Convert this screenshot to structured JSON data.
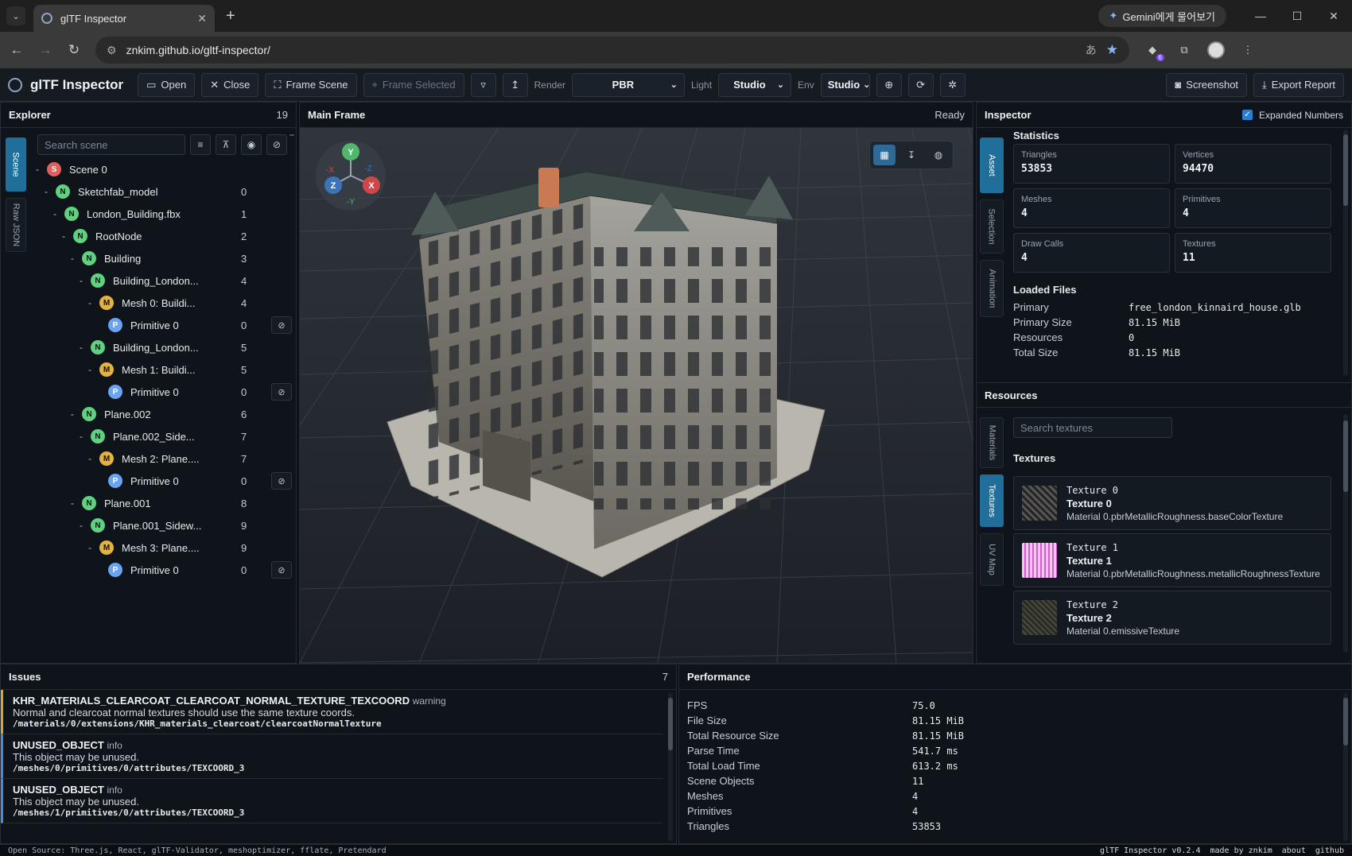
{
  "browser": {
    "tab_title": "glTF Inspector",
    "gemini_label": "Gemini에게 물어보기",
    "url": "znkim.github.io/gltf-inspector/",
    "extension_badge": "6"
  },
  "toolbar": {
    "brand": "glTF Inspector",
    "open": "Open",
    "close": "Close",
    "frame_scene": "Frame Scene",
    "frame_selected": "Frame Selected",
    "render_label": "Render",
    "render_value": "PBR",
    "light_label": "Light",
    "light_value": "Studio",
    "env_label": "Env",
    "env_value": "Studio",
    "screenshot": "Screenshot",
    "export": "Export Report"
  },
  "explorer": {
    "title": "Explorer",
    "count": "19",
    "tabs": [
      "Scene",
      "Raw JSON"
    ],
    "search_placeholder": "Search scene",
    "nodes": [
      {
        "toggle": "-",
        "badge": "S",
        "label": "Scene 0",
        "count": "",
        "depth": 0,
        "eye": false
      },
      {
        "toggle": "-",
        "badge": "N",
        "label": "Sketchfab_model",
        "count": "0",
        "depth": 1,
        "eye": false
      },
      {
        "toggle": "-",
        "badge": "N",
        "label": "London_Building.fbx",
        "count": "1",
        "depth": 2,
        "eye": false
      },
      {
        "toggle": "-",
        "badge": "N",
        "label": "RootNode",
        "count": "2",
        "depth": 3,
        "eye": false
      },
      {
        "toggle": "-",
        "badge": "N",
        "label": "Building",
        "count": "3",
        "depth": 4,
        "eye": false
      },
      {
        "toggle": "-",
        "badge": "N",
        "label": "Building_London...",
        "count": "4",
        "depth": 5,
        "eye": false
      },
      {
        "toggle": "-",
        "badge": "M",
        "label": "Mesh 0: Buildi...",
        "count": "4",
        "depth": 6,
        "eye": false
      },
      {
        "toggle": "",
        "badge": "P",
        "label": "Primitive 0",
        "count": "0",
        "depth": 7,
        "eye": true
      },
      {
        "toggle": "-",
        "badge": "N",
        "label": "Building_London...",
        "count": "5",
        "depth": 5,
        "eye": false
      },
      {
        "toggle": "-",
        "badge": "M",
        "label": "Mesh 1: Buildi...",
        "count": "5",
        "depth": 6,
        "eye": false
      },
      {
        "toggle": "",
        "badge": "P",
        "label": "Primitive 0",
        "count": "0",
        "depth": 7,
        "eye": true
      },
      {
        "toggle": "-",
        "badge": "N",
        "label": "Plane.002",
        "count": "6",
        "depth": 4,
        "eye": false
      },
      {
        "toggle": "-",
        "badge": "N",
        "label": "Plane.002_Side...",
        "count": "7",
        "depth": 5,
        "eye": false
      },
      {
        "toggle": "-",
        "badge": "M",
        "label": "Mesh 2: Plane....",
        "count": "7",
        "depth": 6,
        "eye": false
      },
      {
        "toggle": "",
        "badge": "P",
        "label": "Primitive 0",
        "count": "0",
        "depth": 7,
        "eye": true
      },
      {
        "toggle": "-",
        "badge": "N",
        "label": "Plane.001",
        "count": "8",
        "depth": 4,
        "eye": false
      },
      {
        "toggle": "-",
        "badge": "N",
        "label": "Plane.001_Sidew...",
        "count": "9",
        "depth": 5,
        "eye": false
      },
      {
        "toggle": "-",
        "badge": "M",
        "label": "Mesh 3: Plane....",
        "count": "9",
        "depth": 6,
        "eye": false
      },
      {
        "toggle": "",
        "badge": "P",
        "label": "Primitive 0",
        "count": "0",
        "depth": 7,
        "eye": true
      }
    ]
  },
  "viewport": {
    "title": "Main Frame",
    "status": "Ready",
    "gizmo": {
      "y": "Y",
      "x": "X",
      "z": "Z",
      "nx": "-X",
      "ny": "-Y",
      "nz": "-Z"
    }
  },
  "inspector": {
    "title": "Inspector",
    "expanded_numbers": "Expanded Numbers",
    "tabs": [
      "Asset",
      "Selection",
      "Animation"
    ],
    "statistics_title": "Statistics",
    "stats": [
      {
        "k": "Triangles",
        "v": "53853"
      },
      {
        "k": "Vertices",
        "v": "94470"
      },
      {
        "k": "Meshes",
        "v": "4"
      },
      {
        "k": "Primitives",
        "v": "4"
      },
      {
        "k": "Draw Calls",
        "v": "4"
      },
      {
        "k": "Textures",
        "v": "11"
      }
    ],
    "loaded_files_title": "Loaded Files",
    "files": [
      {
        "k": "Primary",
        "v": "free_london_kinnaird_house.glb"
      },
      {
        "k": "Primary Size",
        "v": "81.15 MiB"
      },
      {
        "k": "Resources",
        "v": "0"
      },
      {
        "k": "Total Size",
        "v": "81.15 MiB"
      }
    ]
  },
  "resources": {
    "title": "Resources",
    "tabs": [
      "Materials",
      "Textures",
      "UV Map"
    ],
    "search_placeholder": "Search textures",
    "textures_title": "Textures",
    "textures": [
      {
        "id": "Texture 0",
        "name": "Texture 0",
        "use": "Material 0.pbrMetallicRoughness.baseColorTexture"
      },
      {
        "id": "Texture 1",
        "name": "Texture 1",
        "use": "Material 0.pbrMetallicRoughness.metallicRoughnessTexture"
      },
      {
        "id": "Texture 2",
        "name": "Texture 2",
        "use": "Material 0.emissiveTexture"
      }
    ]
  },
  "issues": {
    "title": "Issues",
    "count": "7",
    "items": [
      {
        "code": "KHR_MATERIALS_CLEARCOAT_CLEARCOAT_NORMAL_TEXTURE_TEXCOORD",
        "level": "warning",
        "msg": "Normal and clearcoat normal textures should use the same texture coords.",
        "path": "/materials/0/extensions/KHR_materials_clearcoat/clearcoatNormalTexture"
      },
      {
        "code": "UNUSED_OBJECT",
        "level": "info",
        "msg": "This object may be unused.",
        "path": "/meshes/0/primitives/0/attributes/TEXCOORD_3"
      },
      {
        "code": "UNUSED_OBJECT",
        "level": "info",
        "msg": "This object may be unused.",
        "path": "/meshes/1/primitives/0/attributes/TEXCOORD_3"
      }
    ]
  },
  "performance": {
    "title": "Performance",
    "rows": [
      {
        "k": "FPS",
        "v": "75.0"
      },
      {
        "k": "File Size",
        "v": "81.15 MiB"
      },
      {
        "k": "Total Resource Size",
        "v": "81.15 MiB"
      },
      {
        "k": "Parse Time",
        "v": "541.7 ms"
      },
      {
        "k": "Total Load Time",
        "v": "613.2 ms"
      },
      {
        "k": "Scene Objects",
        "v": "11"
      },
      {
        "k": "Meshes",
        "v": "4"
      },
      {
        "k": "Primitives",
        "v": "4"
      },
      {
        "k": "Triangles",
        "v": "53853"
      }
    ]
  },
  "footer": {
    "left": "Open Source: Three.js, React, glTF-Validator, meshoptimizer, fflate, Pretendard",
    "version": "glTF Inspector v0.2.4",
    "made_by": "made by znkim",
    "about": "about",
    "github": "github"
  }
}
